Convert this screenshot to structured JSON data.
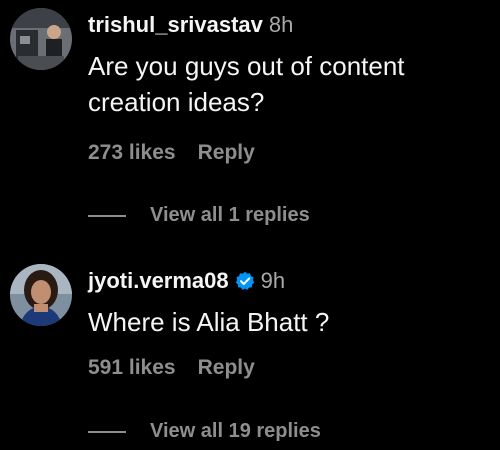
{
  "comments": [
    {
      "username": "trishul_srivastav",
      "time": "8h",
      "text": "Are you guys out of content creation ideas?",
      "likes": "273 likes",
      "reply_label": "Reply",
      "view_replies": "View all 1 replies",
      "verified": false
    },
    {
      "username": "jyoti.verma08",
      "time": "9h",
      "text": "Where is Alia Bhatt ?",
      "likes": "591 likes",
      "reply_label": "Reply",
      "view_replies": "View all 19 replies",
      "verified": true
    }
  ],
  "colors": {
    "background": "#000000",
    "text": "#f5f5f5",
    "muted": "#8e8e8e",
    "verified": "#0095f6"
  }
}
